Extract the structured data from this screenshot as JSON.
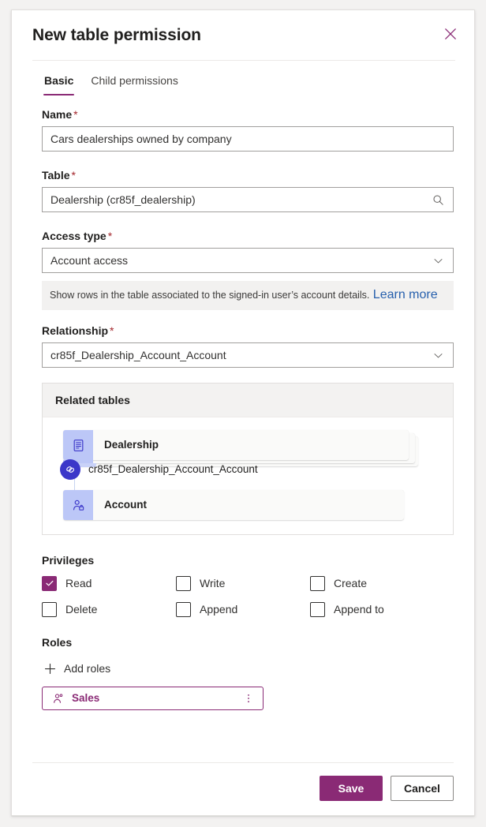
{
  "dialog": {
    "title": "New table permission",
    "close_icon": "close-icon"
  },
  "tabs": [
    {
      "label": "Basic",
      "active": true
    },
    {
      "label": "Child permissions",
      "active": false
    }
  ],
  "fields": {
    "name": {
      "label": "Name",
      "required": "*",
      "value": "Cars dealerships owned by company"
    },
    "table": {
      "label": "Table",
      "required": "*",
      "value": "Dealership (cr85f_dealership)",
      "trailing_icon": "search-icon"
    },
    "access_type": {
      "label": "Access type",
      "required": "*",
      "value": "Account access",
      "trailing_icon": "chevron-down-icon",
      "hint": "Show rows in the table associated to the signed-in user’s account details.",
      "hint_link": "Learn more"
    },
    "relationship": {
      "label": "Relationship",
      "required": "*",
      "value": "cr85f_Dealership_Account_Account",
      "trailing_icon": "chevron-down-icon"
    }
  },
  "related_tables": {
    "title": "Related tables",
    "source": {
      "label": "Dealership",
      "icon": "table-icon",
      "stacked": true
    },
    "relationship": {
      "label": "cr85f_Dealership_Account_Account",
      "icon": "link-icon"
    },
    "target": {
      "label": "Account",
      "icon": "account-icon",
      "stacked": false
    }
  },
  "privileges": {
    "title": "Privileges",
    "items": [
      {
        "label": "Read",
        "checked": true
      },
      {
        "label": "Write",
        "checked": false
      },
      {
        "label": "Create",
        "checked": false
      },
      {
        "label": "Delete",
        "checked": false
      },
      {
        "label": "Append",
        "checked": false
      },
      {
        "label": "Append to",
        "checked": false
      }
    ]
  },
  "roles": {
    "title": "Roles",
    "add_label": "Add roles",
    "add_icon": "plus-icon",
    "items": [
      {
        "name": "Sales",
        "icon": "role-person-icon",
        "more_icon": "more-vertical-icon"
      }
    ]
  },
  "footer": {
    "save_label": "Save",
    "cancel_label": "Cancel"
  },
  "colors": {
    "accent": "#8a2a75",
    "link": "#2760ad",
    "required": "#a4262c",
    "node_icon_bg": "#bcc7f7",
    "relationship_icon_bg": "#3b37c9"
  }
}
